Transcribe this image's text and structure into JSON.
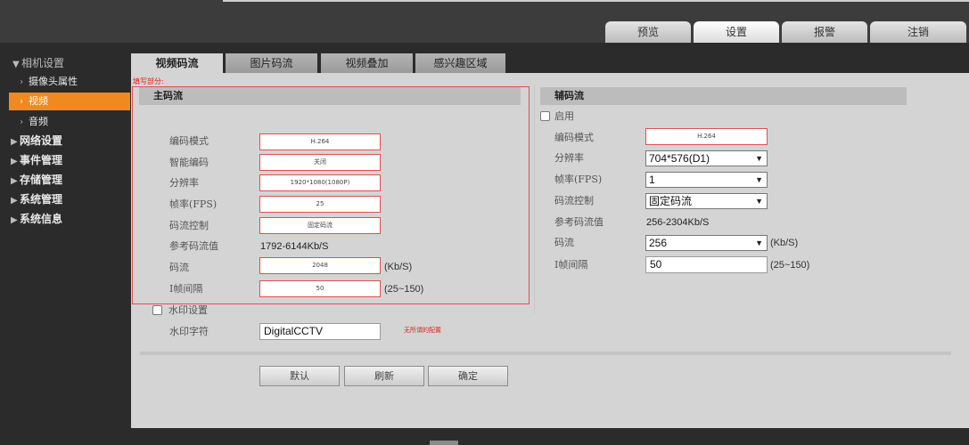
{
  "top_nav": [
    {
      "label": "预览",
      "active": false
    },
    {
      "label": "设置",
      "active": true
    },
    {
      "label": "报警",
      "active": false
    },
    {
      "label": "注销",
      "active": false
    }
  ],
  "sidebar": {
    "camera_settings": "相机设置",
    "camera_properties": "摄像头属性",
    "video": "视频",
    "audio": "音频",
    "network_settings": "网络设置",
    "event_management": "事件管理",
    "storage_management": "存储管理",
    "system_management": "系统管理",
    "system_info": "系统信息"
  },
  "tabs": [
    "视频码流",
    "图片码流",
    "视频叠加",
    "感兴趣区域"
  ],
  "annotations": {
    "fill_area": "填写部分:",
    "no_config": "无所谓的配置"
  },
  "main_stream": {
    "title": "主码流",
    "labels": {
      "encoding": "编码模式",
      "smart_encoding": "智能编码",
      "resolution": "分辨率",
      "fps": "帧率(FPS)",
      "bitrate_control": "码流控制",
      "ref_bitrate": "参考码流值",
      "bitrate": "码流",
      "i_frame": "I帧间隔"
    },
    "values": {
      "encoding": "H.264",
      "smart_encoding": "关闭",
      "resolution": "1920*1080(1080P)",
      "fps": "25",
      "bitrate_control": "固定码流",
      "ref_bitrate": "1792-6144Kb/S",
      "bitrate": "2048",
      "i_frame": "50"
    },
    "units": {
      "bitrate": "(Kb/S)",
      "i_frame": "(25~150)"
    }
  },
  "watermark": {
    "enable_label": "水印设置",
    "text_label": "水印字符",
    "text_value": "DigitalCCTV"
  },
  "sub_stream": {
    "title": "辅码流",
    "enable_label": "启用",
    "labels": {
      "encoding": "编码模式",
      "resolution": "分辨率",
      "fps": "帧率(FPS)",
      "bitrate_control": "码流控制",
      "ref_bitrate": "参考码流值",
      "bitrate": "码流",
      "i_frame": "I帧间隔"
    },
    "values": {
      "encoding": "H.264",
      "resolution": "704*576(D1)",
      "fps": "1",
      "bitrate_control": "固定码流",
      "ref_bitrate": "256-2304Kb/S",
      "bitrate": "256",
      "i_frame": "50"
    },
    "units": {
      "bitrate": "(Kb/S)",
      "i_frame": "(25~150)"
    }
  },
  "buttons": {
    "default": "默认",
    "refresh": "刷新",
    "ok": "确定"
  },
  "colors": {
    "accent": "#f08a1e",
    "highlight_border": "#e05050",
    "annotation_text": "#e02020"
  }
}
